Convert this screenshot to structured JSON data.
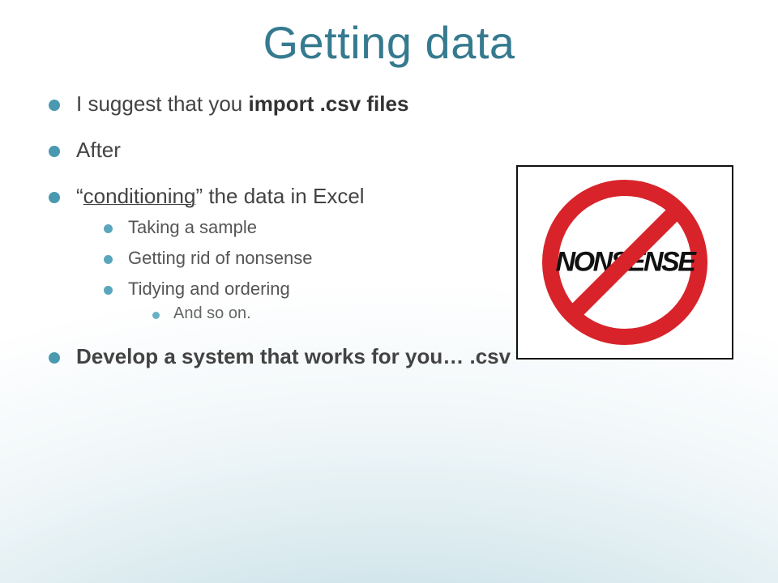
{
  "title": "Getting data",
  "bullets": {
    "b1_prefix": "I suggest that you ",
    "b1_bold": "import .csv files",
    "b2": "After",
    "b3_open": "“",
    "b3_underline": "conditioning",
    "b3_rest": "” the data in Excel",
    "b3_sub1": "Taking a sample",
    "b3_sub2": "Getting rid of nonsense",
    "b3_sub3": "Tidying and ordering",
    "b3_sub3_sub1": "And so on.",
    "b4": "Develop a system that works for you…  .csv"
  },
  "image": {
    "label": "NONSENSE",
    "semantic": "no-nonsense-sign"
  },
  "colors": {
    "accent": "#357a8f",
    "bullet": "#4a99b1",
    "prohibit": "#d8232a"
  }
}
